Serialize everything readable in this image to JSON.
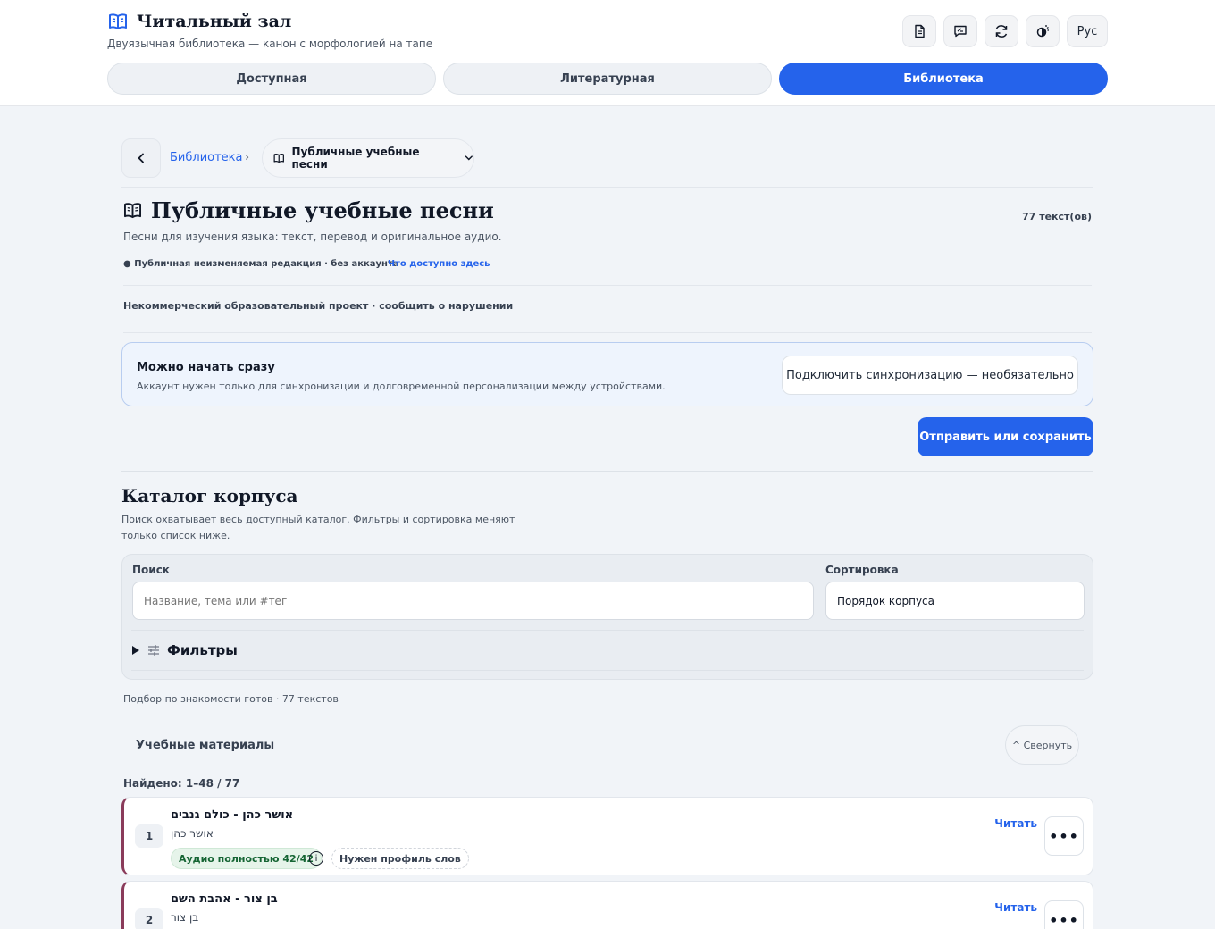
{
  "app": {
    "title": "Читальный зал",
    "subtitle": "Двуязычная библиотека — канон с морфологией на тапе",
    "lang_button": "Рус"
  },
  "tabs": [
    "Доступная",
    "Литературная",
    "Библиотека"
  ],
  "breadcrumb": {
    "link": "Библиотека",
    "separator": "›",
    "current": "Публичные учебные песни"
  },
  "collection": {
    "title": "Публичные учебные песни",
    "count": "77 текст(ов)",
    "description": "Песни для изучения языка: текст, перевод и оригинальное аудио.",
    "public_note": "● Публичная неизменяемая редакция · без аккаунта",
    "public_link": "Что доступно здесь",
    "noncommercial": "Некоммерческий образовательный проект · сообщить о нарушении"
  },
  "start_box": {
    "heading": "Можно начать сразу",
    "text": "Аккаунт нужен только для синхронизации и долговременной персонализации между устройствами.",
    "sync_button": "Подключить синхронизацию — необязательно"
  },
  "send_button": "Отправить или сохранить",
  "catalog": {
    "title": "Каталог корпуса",
    "description": "Поиск охватывает весь доступный каталог. Фильтры и сортировка меняют только список ниже.",
    "search_label": "Поиск",
    "search_placeholder": "Название, тема или #тег",
    "sort_label": "Сортировка",
    "sort_value": "Порядок корпуса",
    "filters_label": "Фильтры",
    "match_note": "Подбор по знакомости готов · 77 текстов"
  },
  "materials": {
    "title": "Учебные материалы",
    "collapse_button": "^ Свернуть",
    "found": "Найдено: 1–48 / 77",
    "read_label": "Читать",
    "items": [
      {
        "num": "1",
        "title": "אושר כהן - כולם גנבים",
        "author": "אושר כהן",
        "audio_badge": "Аудио полностью 42/42",
        "profile_badge": "Нужен профиль слов"
      },
      {
        "num": "2",
        "title": "בן צור - אהבת השם",
        "author": "בן צור"
      }
    ]
  },
  "colors": {
    "accent": "#2563eb",
    "item_border": "#8a3b5a",
    "audio_badge": "#166534"
  }
}
